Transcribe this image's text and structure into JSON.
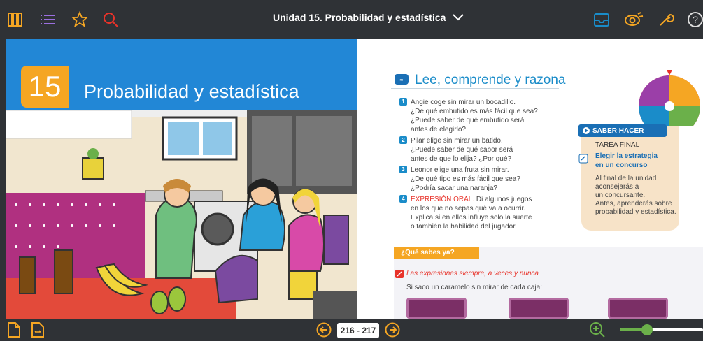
{
  "header": {
    "title": "Unidad 15. Probabilidad y estadística",
    "icons": [
      "library-icon",
      "list-icon",
      "star-icon",
      "search-icon",
      "inbox-icon",
      "eye-icon",
      "wrench-icon",
      "help-icon"
    ],
    "help_label": "?"
  },
  "colors": {
    "accent": "#f5a623",
    "blue": "#1a8cc9",
    "bar": "#2f3236"
  },
  "left_page": {
    "unit_number": "15",
    "unit_title": "Probabilidad y estadística"
  },
  "right_page": {
    "section_title": "Lee, comprende y razona",
    "questions": [
      {
        "num": "1",
        "lines": [
          "Angie coge sin mirar un bocadillo.",
          "¿De qué embutido es más fácil que sea?",
          "¿Puede saber de qué embutido será",
          "antes de elegirlo?"
        ]
      },
      {
        "num": "2",
        "lines": [
          "Pilar elige sin mirar un batido.",
          "¿Puede saber de qué sabor será",
          "antes de que lo elija? ¿Por qué?"
        ]
      },
      {
        "num": "3",
        "lines": [
          "Leonor elige una fruta sin mirar.",
          "¿De qué tipo es más fácil que sea?",
          "¿Podría sacar una naranja?"
        ]
      },
      {
        "num": "4",
        "highlight": "EXPRESIÓN ORAL.",
        "lines": [
          "Di algunos juegos",
          "en los que no sepas qué va a ocurrir.",
          "Explica si en ellos influye solo la suerte",
          "o también la habilidad del jugador."
        ]
      }
    ],
    "saber_hacer": {
      "header": "SABER HACER",
      "tarea": "TAREA FINAL",
      "subtitle_1": "Elegir la estrategia",
      "subtitle_2": "en un concurso",
      "text": [
        "Al final de la unidad",
        "aconsejarás a",
        "un concursante.",
        "Antes, aprenderás sobre",
        "probabilidad y estadística."
      ]
    },
    "que_sabes": {
      "tag": "¿Qué sabes ya?",
      "subtitle": "Las expresiones siempre, a veces y nunca",
      "text": "Si saco un caramelo sin mirar de cada caja:"
    }
  },
  "footer": {
    "page_range": "216 - 217",
    "zoom_level": 0.33
  }
}
